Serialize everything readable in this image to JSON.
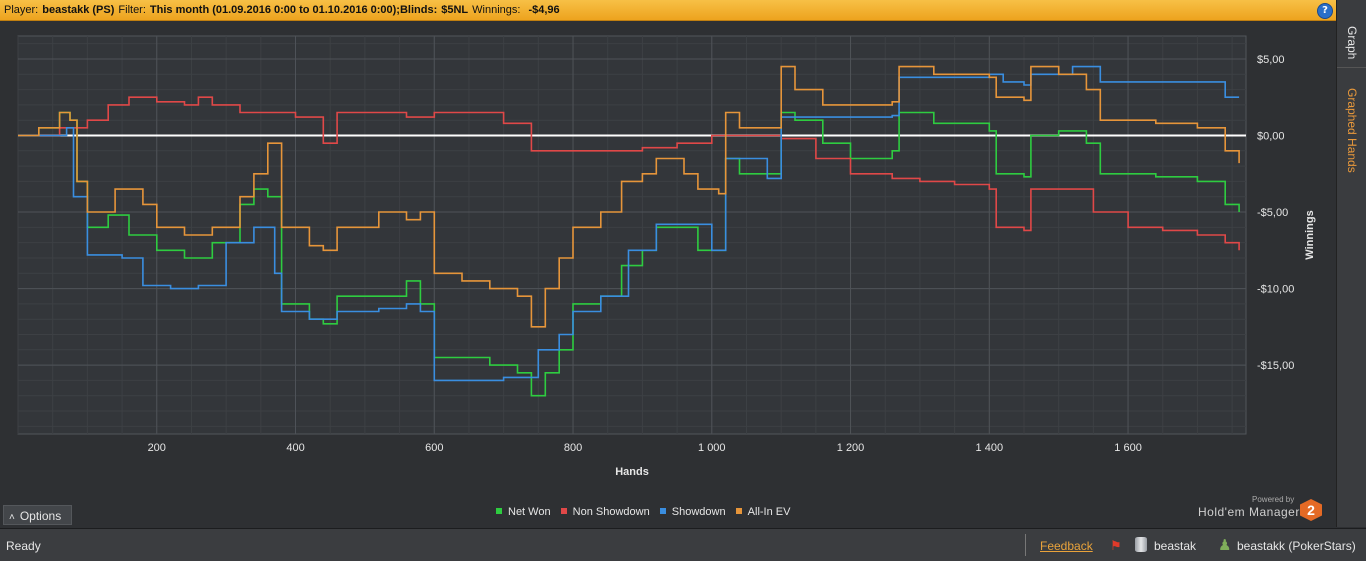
{
  "header": {
    "player_label": "Player:",
    "player_value": "beastakk (PS)",
    "filter_label": "Filter:",
    "filter_value": "This month (01.09.2016 0:00 to 01.10.2016 0:00);",
    "blinds_label": "Blinds:",
    "blinds_value": "$5NL",
    "winnings_label": "Winnings:",
    "winnings_value": "-$4,96",
    "help_icon": "?"
  },
  "side_tabs": {
    "graph": "Graph",
    "graphed_hands": "Graphed Hands"
  },
  "options_label": "Options",
  "legend": [
    {
      "label": "Net Won",
      "color": "#2ecc40"
    },
    {
      "label": "Non Showdown",
      "color": "#e04848"
    },
    {
      "label": "Showdown",
      "color": "#3a8ee0"
    },
    {
      "label": "All-In EV",
      "color": "#e6953a"
    }
  ],
  "brand": {
    "powered_by": "Powered by",
    "name": "Hold'em Manager",
    "logo_text": "2"
  },
  "status": {
    "ready": "Ready",
    "feedback": "Feedback",
    "database": "beastak",
    "user": "beastakk (PokerStars)"
  },
  "chart_data": {
    "type": "line",
    "xlabel": "Hands",
    "ylabel": "Winnings",
    "xlim": [
      0,
      1770
    ],
    "ylim": [
      -19.5,
      6.5
    ],
    "x_ticks": [
      200,
      400,
      600,
      800,
      1000,
      1200,
      1400,
      1600
    ],
    "x_tick_labels": [
      "200",
      "400",
      "600",
      "800",
      "1 000",
      "1 200",
      "1 400",
      "1 600"
    ],
    "y_ticks": [
      5,
      0,
      -5,
      -10,
      -15
    ],
    "y_tick_labels": [
      "$5,00",
      "$0,00",
      "-$5,00",
      "-$10,00",
      "-$15,00"
    ],
    "grid": true,
    "series": [
      {
        "name": "Net Won",
        "color": "#2ecc40",
        "points": [
          [
            0,
            0
          ],
          [
            30,
            0.5
          ],
          [
            60,
            1.5
          ],
          [
            75,
            1
          ],
          [
            85,
            -3
          ],
          [
            100,
            -6
          ],
          [
            130,
            -5.2
          ],
          [
            160,
            -6.5
          ],
          [
            200,
            -7.5
          ],
          [
            240,
            -8
          ],
          [
            280,
            -7
          ],
          [
            320,
            -4.5
          ],
          [
            340,
            -3.5
          ],
          [
            360,
            -4
          ],
          [
            380,
            -11
          ],
          [
            420,
            -12
          ],
          [
            440,
            -12.3
          ],
          [
            460,
            -10.5
          ],
          [
            520,
            -10.5
          ],
          [
            560,
            -9.5
          ],
          [
            580,
            -11
          ],
          [
            600,
            -14.5
          ],
          [
            640,
            -14.5
          ],
          [
            680,
            -15
          ],
          [
            720,
            -15.5
          ],
          [
            740,
            -17
          ],
          [
            760,
            -15.5
          ],
          [
            780,
            -14
          ],
          [
            800,
            -11
          ],
          [
            840,
            -10.5
          ],
          [
            870,
            -8.5
          ],
          [
            900,
            -7.5
          ],
          [
            920,
            -6
          ],
          [
            960,
            -6
          ],
          [
            980,
            -7.5
          ],
          [
            1010,
            -7.5
          ],
          [
            1020,
            -1.5
          ],
          [
            1040,
            -2.5
          ],
          [
            1080,
            -2.5
          ],
          [
            1100,
            1.5
          ],
          [
            1120,
            1
          ],
          [
            1160,
            -0.5
          ],
          [
            1200,
            -1.5
          ],
          [
            1260,
            -1
          ],
          [
            1270,
            1.5
          ],
          [
            1320,
            0.8
          ],
          [
            1400,
            0.3
          ],
          [
            1410,
            -2.5
          ],
          [
            1450,
            -2.7
          ],
          [
            1460,
            0
          ],
          [
            1500,
            0.3
          ],
          [
            1540,
            -0.5
          ],
          [
            1560,
            -2.5
          ],
          [
            1640,
            -2.7
          ],
          [
            1700,
            -3
          ],
          [
            1740,
            -4.5
          ],
          [
            1760,
            -5
          ]
        ]
      },
      {
        "name": "Non Showdown",
        "color": "#e04848",
        "points": [
          [
            0,
            0
          ],
          [
            60,
            0.5
          ],
          [
            100,
            1
          ],
          [
            130,
            2
          ],
          [
            160,
            2.5
          ],
          [
            200,
            2.2
          ],
          [
            240,
            2
          ],
          [
            260,
            2.5
          ],
          [
            280,
            2
          ],
          [
            320,
            1.5
          ],
          [
            360,
            1.5
          ],
          [
            400,
            1.2
          ],
          [
            440,
            -0.5
          ],
          [
            460,
            1.5
          ],
          [
            520,
            1.5
          ],
          [
            560,
            1.2
          ],
          [
            600,
            1.5
          ],
          [
            700,
            0.8
          ],
          [
            740,
            -1
          ],
          [
            800,
            -1
          ],
          [
            850,
            -1
          ],
          [
            900,
            -0.8
          ],
          [
            950,
            -0.5
          ],
          [
            1000,
            0
          ],
          [
            1050,
            0
          ],
          [
            1100,
            -0.2
          ],
          [
            1150,
            -1.5
          ],
          [
            1200,
            -2.5
          ],
          [
            1260,
            -2.8
          ],
          [
            1300,
            -3
          ],
          [
            1350,
            -3.2
          ],
          [
            1400,
            -3.5
          ],
          [
            1410,
            -6
          ],
          [
            1450,
            -6.2
          ],
          [
            1460,
            -3.5
          ],
          [
            1500,
            -3.5
          ],
          [
            1550,
            -5
          ],
          [
            1600,
            -6
          ],
          [
            1650,
            -6.2
          ],
          [
            1700,
            -6.5
          ],
          [
            1740,
            -7
          ],
          [
            1760,
            -7.5
          ]
        ]
      },
      {
        "name": "Showdown",
        "color": "#3a8ee0",
        "points": [
          [
            0,
            0
          ],
          [
            70,
            0.5
          ],
          [
            80,
            -4
          ],
          [
            100,
            -7.8
          ],
          [
            150,
            -8
          ],
          [
            180,
            -9.8
          ],
          [
            220,
            -10
          ],
          [
            260,
            -9.8
          ],
          [
            300,
            -7
          ],
          [
            340,
            -6
          ],
          [
            370,
            -9
          ],
          [
            380,
            -11.5
          ],
          [
            420,
            -12
          ],
          [
            460,
            -11.5
          ],
          [
            520,
            -11.3
          ],
          [
            560,
            -11
          ],
          [
            580,
            -11.5
          ],
          [
            600,
            -16
          ],
          [
            650,
            -16
          ],
          [
            700,
            -15.8
          ],
          [
            740,
            -15.8
          ],
          [
            750,
            -14
          ],
          [
            780,
            -13
          ],
          [
            800,
            -11.5
          ],
          [
            840,
            -10.5
          ],
          [
            880,
            -7.5
          ],
          [
            920,
            -5.8
          ],
          [
            960,
            -5.8
          ],
          [
            1000,
            -7.5
          ],
          [
            1020,
            -1.5
          ],
          [
            1080,
            -2.8
          ],
          [
            1100,
            1.2
          ],
          [
            1200,
            1.2
          ],
          [
            1260,
            1.3
          ],
          [
            1270,
            3.8
          ],
          [
            1380,
            3.8
          ],
          [
            1400,
            4
          ],
          [
            1420,
            3.5
          ],
          [
            1450,
            3.3
          ],
          [
            1460,
            4
          ],
          [
            1520,
            4.5
          ],
          [
            1540,
            4.5
          ],
          [
            1560,
            3.5
          ],
          [
            1700,
            3.5
          ],
          [
            1740,
            2.5
          ],
          [
            1760,
            2.5
          ]
        ]
      },
      {
        "name": "All-In EV",
        "color": "#e6953a",
        "points": [
          [
            0,
            0
          ],
          [
            30,
            0.5
          ],
          [
            60,
            1.5
          ],
          [
            75,
            1
          ],
          [
            85,
            -3
          ],
          [
            100,
            -5
          ],
          [
            140,
            -3.5
          ],
          [
            180,
            -4.5
          ],
          [
            200,
            -6
          ],
          [
            240,
            -6.5
          ],
          [
            280,
            -6
          ],
          [
            320,
            -4
          ],
          [
            340,
            -2.5
          ],
          [
            360,
            -0.5
          ],
          [
            380,
            -6
          ],
          [
            420,
            -7.2
          ],
          [
            440,
            -7.5
          ],
          [
            460,
            -6
          ],
          [
            520,
            -5
          ],
          [
            560,
            -5.5
          ],
          [
            580,
            -5
          ],
          [
            600,
            -9
          ],
          [
            640,
            -9.5
          ],
          [
            680,
            -10
          ],
          [
            720,
            -10.5
          ],
          [
            740,
            -12.5
          ],
          [
            760,
            -10
          ],
          [
            780,
            -8
          ],
          [
            800,
            -6
          ],
          [
            840,
            -5
          ],
          [
            870,
            -3
          ],
          [
            900,
            -2.5
          ],
          [
            920,
            -1.5
          ],
          [
            960,
            -2.5
          ],
          [
            980,
            -3.5
          ],
          [
            1010,
            -3.8
          ],
          [
            1020,
            1.5
          ],
          [
            1040,
            0.5
          ],
          [
            1080,
            0.5
          ],
          [
            1100,
            4.5
          ],
          [
            1120,
            3
          ],
          [
            1160,
            2
          ],
          [
            1200,
            2
          ],
          [
            1260,
            2.2
          ],
          [
            1270,
            4.5
          ],
          [
            1320,
            4
          ],
          [
            1380,
            4
          ],
          [
            1400,
            3.8
          ],
          [
            1410,
            2.5
          ],
          [
            1450,
            2.3
          ],
          [
            1460,
            4.5
          ],
          [
            1500,
            4
          ],
          [
            1540,
            3
          ],
          [
            1560,
            1
          ],
          [
            1640,
            0.8
          ],
          [
            1700,
            0.5
          ],
          [
            1740,
            -1
          ],
          [
            1760,
            -1.8
          ]
        ]
      }
    ]
  }
}
